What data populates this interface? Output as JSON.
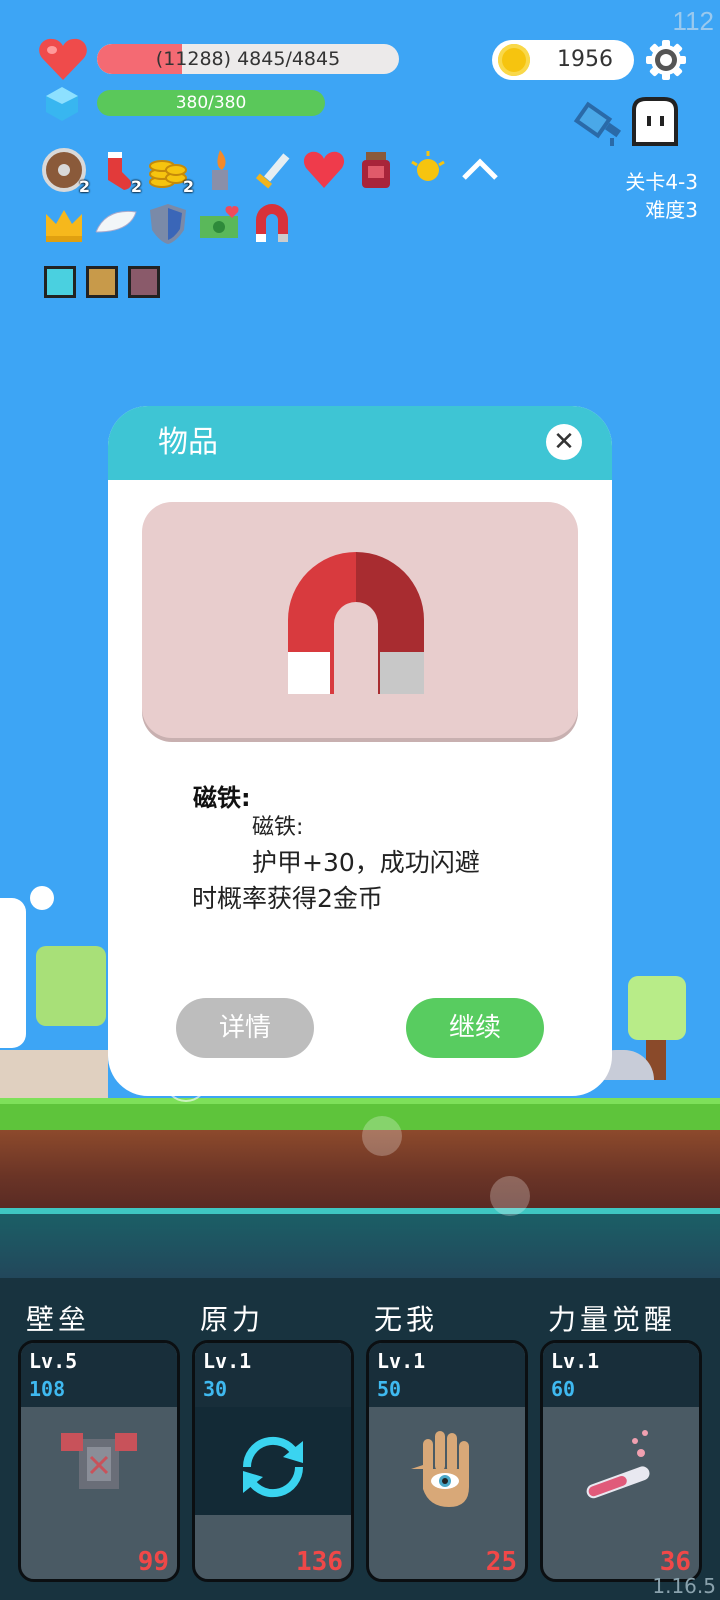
{
  "fps": "112",
  "hud": {
    "hp_text": "(11288) 4845/4845",
    "hp_fraction": 0.28,
    "mp_text": "380/380",
    "mp_fraction": 1.0,
    "gold": "1956",
    "level_stage": "关卡4-3",
    "level_difficulty": "难度3"
  },
  "buffs_row1": [
    {
      "icon": "round-shield-icon",
      "count": "2"
    },
    {
      "icon": "red-sock-icon",
      "count": "2"
    },
    {
      "icon": "gold-coins-icon",
      "count": "2"
    },
    {
      "icon": "flame-statue-icon",
      "count": ""
    },
    {
      "icon": "sword-icon",
      "count": ""
    },
    {
      "icon": "heart-icon",
      "count": ""
    },
    {
      "icon": "jam-jar-icon",
      "count": ""
    },
    {
      "icon": "sun-orb-icon",
      "count": ""
    },
    {
      "icon": "chevron-up-icon",
      "count": ""
    }
  ],
  "buffs_row2": [
    "crown-icon",
    "wings-icon",
    "shield-icon",
    "cash-heart-icon",
    "magnet-icon"
  ],
  "buffs_row3": [
    "light-gem-icon",
    "armor-tile-icon",
    "sword-tile-icon"
  ],
  "dialog": {
    "title": "物品",
    "item_name": "磁铁:",
    "desc_line1": "磁铁:",
    "desc_line2": "护甲+30，成功闪避",
    "desc_line3": "时概率获得2金币",
    "detail_label": "详情",
    "continue_label": "继续",
    "item_icon": "magnet-icon"
  },
  "skills": [
    {
      "title": "壁垒",
      "level": "Lv.5",
      "cost": "108",
      "count": "99",
      "icon": "armor-icon"
    },
    {
      "title": "原力",
      "level": "Lv.1",
      "cost": "30",
      "count": "136",
      "icon": "refresh-icon"
    },
    {
      "title": "无我",
      "level": "Lv.1",
      "cost": "50",
      "count": "25",
      "icon": "eye-hand-icon"
    },
    {
      "title": "力量觉醒",
      "level": "Lv.1",
      "cost": "60",
      "count": "36",
      "icon": "potion-tube-icon"
    }
  ],
  "version": "1.16.5",
  "colors": {
    "hp": "#f46a73",
    "mp": "#5ac85a",
    "dialog_header": "#3ec5d4",
    "continue": "#58cc60",
    "detail": "#bdbdbd"
  }
}
